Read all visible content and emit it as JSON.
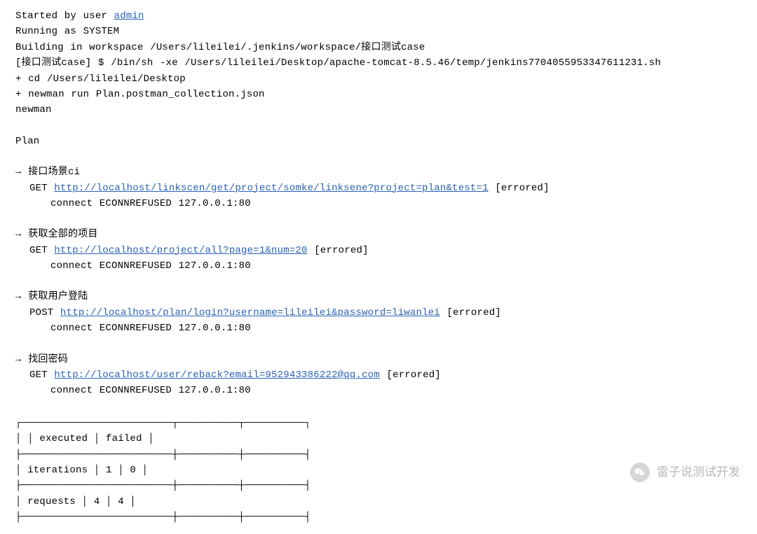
{
  "log": {
    "l0_a": "Started by user ",
    "l0_link": "admin",
    "l1": "Running as SYSTEM",
    "l2": "Building in workspace /Users/lileilei/.jenkins/workspace/接口测试case",
    "l3": "[接口测试case] $ /bin/sh -xe /Users/lileilei/Desktop/apache-tomcat-8.5.46/temp/jenkins7704055953347611231.sh",
    "l4": "+ cd /Users/lileilei/Desktop",
    "l5": "+ newman run Plan.postman_collection.json",
    "l6": "newman",
    "l7": "Plan"
  },
  "arrow": "→ ",
  "cases": [
    {
      "name": "接口场景ci",
      "method": "GET",
      "url": "http://localhost/linkscen/get/project/somke/linksene?project=plan&test=1",
      "status": " [errored]",
      "error": "connect ECONNREFUSED 127.0.0.1:80"
    },
    {
      "name": "获取全部的项目",
      "method": "GET",
      "url": "http://localhost/project/all?page=1&num=20",
      "status": " [errored]",
      "error": "connect ECONNREFUSED 127.0.0.1:80"
    },
    {
      "name": "获取用户登陆",
      "method": "POST",
      "url": "http://localhost/plan/login?username=lileilei&password=liwanlei",
      "status": " [errored]",
      "error": "connect ECONNREFUSED 127.0.0.1:80"
    },
    {
      "name": "找回密码",
      "method": "GET",
      "url": "http://localhost/user/reback?email=952943386222@qq.com",
      "status": " [errored]",
      "error": "connect ECONNREFUSED 127.0.0.1:80"
    }
  ],
  "table": {
    "top": "┌─────────────────────────┬──────────┬──────────┐",
    "header": "│                         │ executed │   failed │",
    "sep": "├─────────────────────────┼──────────┼──────────┤",
    "row1": "│              iterations │        1 │        0 │",
    "row2": "│                requests │        4 │        4 │"
  },
  "chart_data": {
    "type": "table",
    "columns": [
      "",
      "executed",
      "failed"
    ],
    "rows": [
      {
        "label": "iterations",
        "executed": 1,
        "failed": 0
      },
      {
        "label": "requests",
        "executed": 4,
        "failed": 4
      }
    ]
  },
  "watermark": "雷子说测试开发"
}
